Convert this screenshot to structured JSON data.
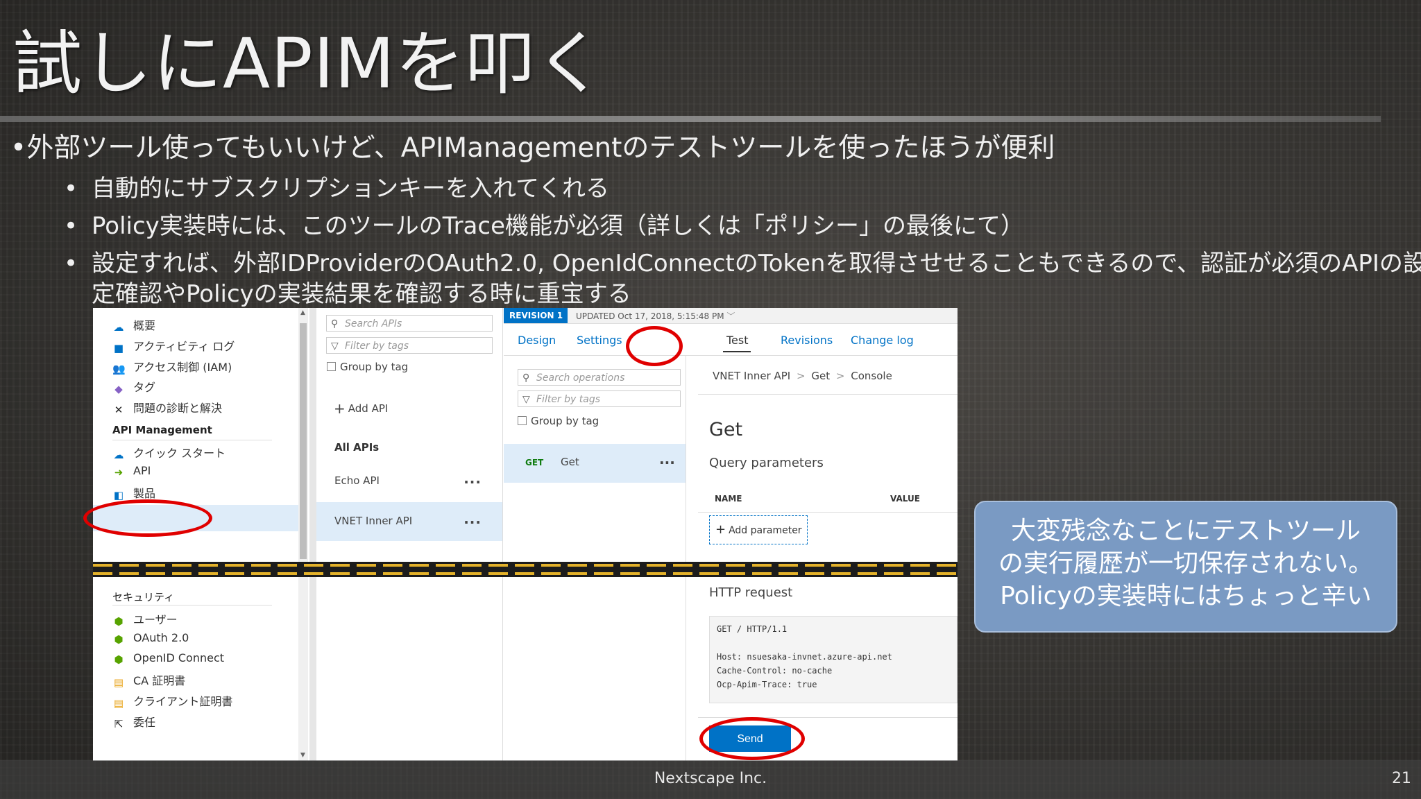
{
  "slide": {
    "title": "試しにAPIMを叩く",
    "bullet_main": "外部ツール使ってもいいけど、APIManagementのテストツールを使ったほうが便利",
    "bullet_sub1": "自動的にサブスクリプションキーを入れてくれる",
    "bullet_sub2": "Policy実装時には、このツールのTrace機能が必須（詳しくは「ポリシー」の最後にて）",
    "bullet_sub3_line1": "設定すれば、外部IDProviderのOAuth2.0, OpenIdConnectのTokenを取得させせることもできるので、認証が必須のAPIの設",
    "bullet_sub3_line2": "定確認やPolicyの実装結果を確認する時に重宝する",
    "bullet_glyph": "•",
    "callout_line1": "大変残念なことにテストツール",
    "callout_line2": "の実行履歴が一切保存されない。",
    "callout_line3": "Policyの実装時にはちょっと辛い",
    "footer": "Nextscape Inc.",
    "page_number": "21"
  },
  "nav": {
    "items_top": [
      {
        "label": "概要",
        "icon": "cloud-icon",
        "color": "#0072c6"
      },
      {
        "label": "アクティビティ ログ",
        "icon": "log-icon",
        "color": "#0072c6"
      },
      {
        "label": "アクセス制御 (IAM)",
        "icon": "people-icon",
        "color": "#0072c6"
      },
      {
        "label": "タグ",
        "icon": "tag-icon",
        "color": "#8661c5"
      },
      {
        "label": "問題の診断と解決",
        "icon": "wrench-icon",
        "color": "#222222"
      }
    ],
    "section_api": "API Management",
    "items_api": [
      {
        "label": "クイック スタート",
        "icon": "cloud-icon",
        "color": "#0072c6"
      },
      {
        "label": "API",
        "icon": "arrow-icon",
        "color": "#57a300"
      },
      {
        "label": "製品",
        "icon": "cube-icon",
        "color": "#0072c6"
      }
    ],
    "section_security": "セキュリティ",
    "items_security": [
      {
        "label": "ユーザー",
        "icon": "shield-icon",
        "color": "#57a300"
      },
      {
        "label": "OAuth 2.0",
        "icon": "shield-icon",
        "color": "#57a300"
      },
      {
        "label": "OpenID Connect",
        "icon": "shield-icon",
        "color": "#57a300"
      },
      {
        "label": "CA 証明書",
        "icon": "certificate-icon",
        "color": "#e8a317"
      },
      {
        "label": "クライアント証明書",
        "icon": "certificate-icon",
        "color": "#e8a317"
      },
      {
        "label": "委任",
        "icon": "delegate-icon",
        "color": "#222222"
      }
    ]
  },
  "apis": {
    "search_placeholder": "Search APIs",
    "filter_placeholder": "Filter by tags",
    "group_by_tag": "Group by tag",
    "add_api": "Add API",
    "all_apis": "All APIs",
    "list": [
      {
        "name": "Echo API",
        "more": "..."
      },
      {
        "name": "VNET Inner API",
        "more": "...",
        "selected": true
      }
    ]
  },
  "revision": {
    "badge": "REVISION 1",
    "updated": "UPDATED Oct 17, 2018, 5:15:48 PM"
  },
  "tabs": [
    {
      "label": "Design"
    },
    {
      "label": "Settings"
    },
    {
      "label": "Test",
      "active": true
    },
    {
      "label": "Revisions"
    },
    {
      "label": "Change log"
    }
  ],
  "operations": {
    "search_placeholder": "Search operations",
    "filter_placeholder": "Filter by tags",
    "group_by_tag": "Group by tag",
    "selected_method": "GET",
    "selected_name": "Get",
    "more": "..."
  },
  "console": {
    "breadcrumb": [
      "VNET Inner API",
      "Get",
      "Console"
    ],
    "breadcrumb_sep": ">",
    "heading": "Get",
    "query_params_label": "Query parameters",
    "col_name": "NAME",
    "col_value": "VALUE",
    "add_parameter": "Add parameter",
    "http_request_label": "HTTP request",
    "request_line": "GET / HTTP/1.1",
    "headers": [
      "Host: nsuesaka-invnet.azure-api.net",
      "Cache-Control: no-cache",
      "Ocp-Apim-Trace: true"
    ],
    "send_label": "Send"
  },
  "colors": {
    "azure_blue": "#0072c6",
    "highlight_red": "#e00000",
    "callout_bg": "#7a9ac3",
    "cut_dash": "#e3b12a"
  }
}
